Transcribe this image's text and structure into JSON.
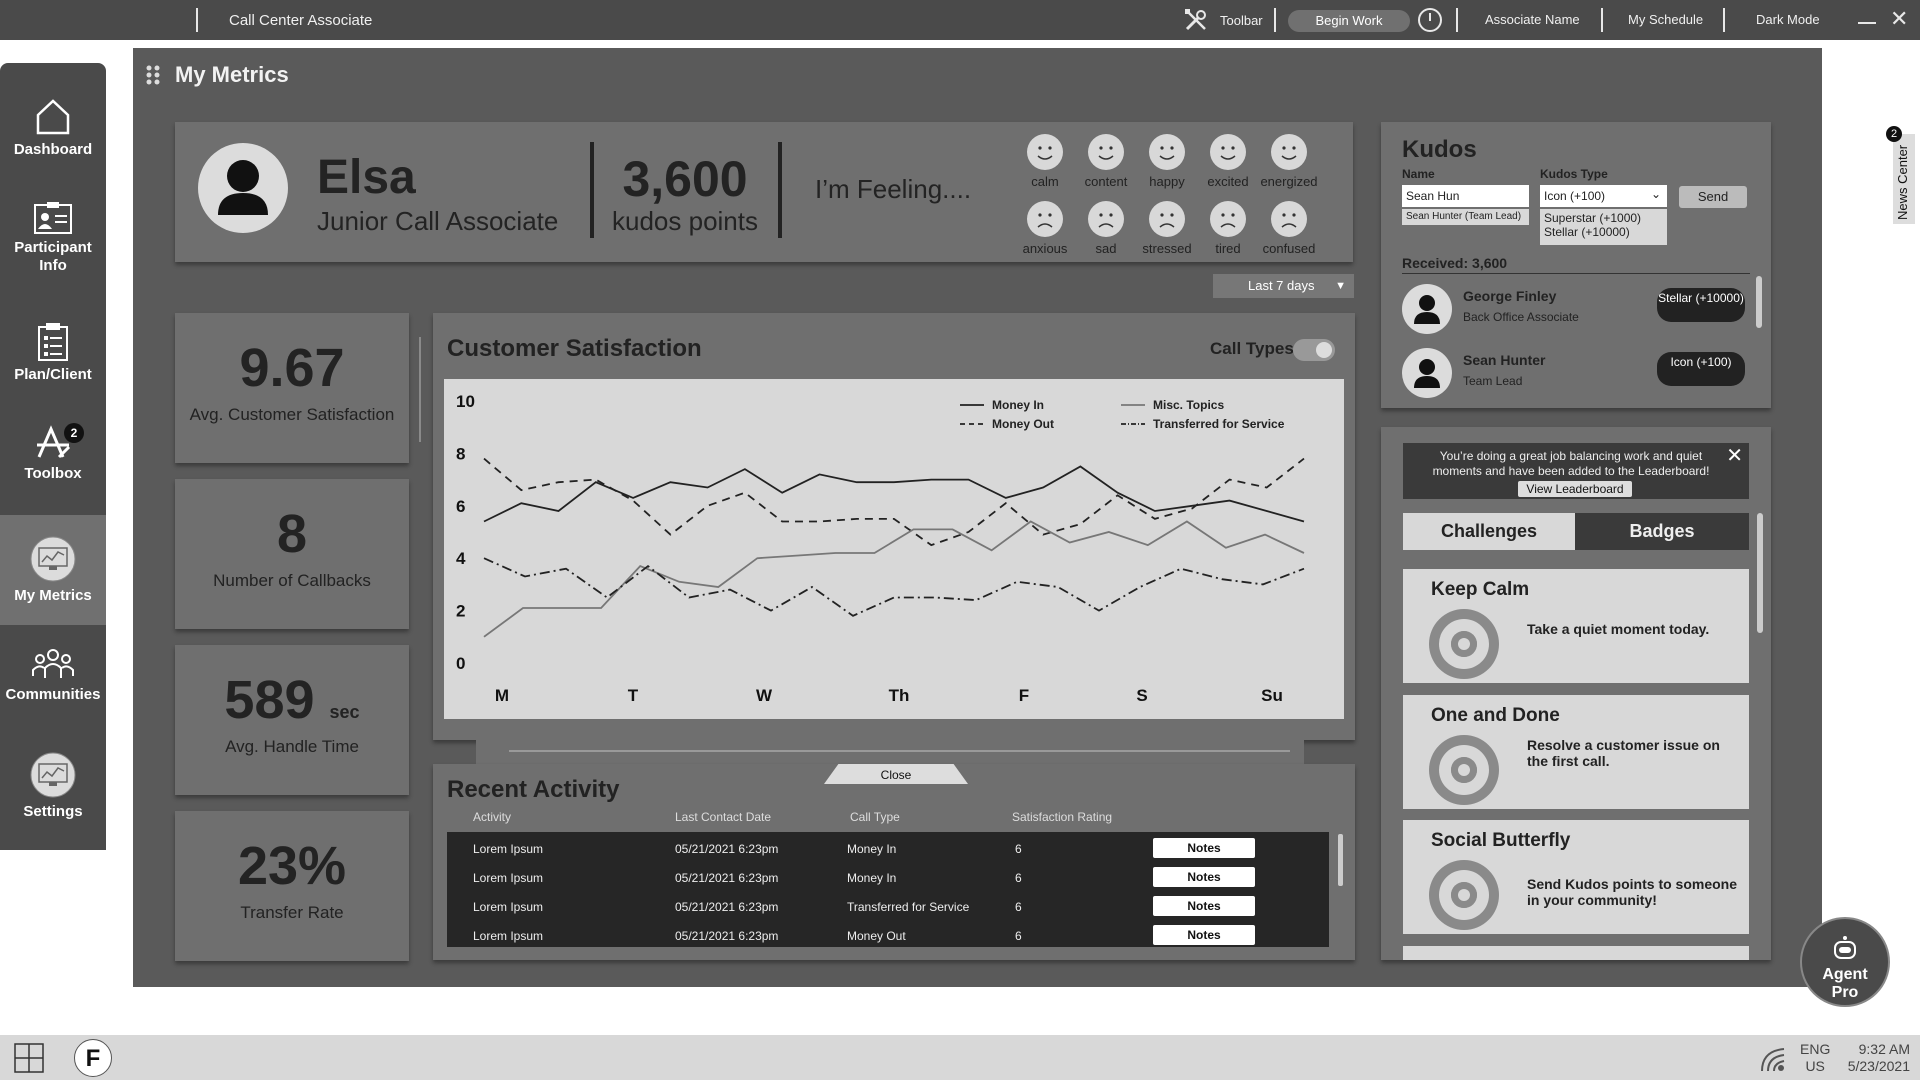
{
  "topbar": {
    "app_title": "Call Center Associate",
    "toolbar_label": "Toolbar",
    "begin_work": "Begin Work",
    "associate_name": "Associate Name",
    "my_schedule": "My Schedule",
    "dark_mode": "Dark Mode"
  },
  "sidebar": {
    "items": [
      {
        "label": "Dashboard",
        "icon": "home-icon"
      },
      {
        "label": "Participant Info",
        "icon": "id-card-icon"
      },
      {
        "label": "Plan/Client",
        "icon": "clipboard-icon"
      },
      {
        "label": "Toolbox",
        "icon": "toolbox-icon",
        "badge": "2"
      },
      {
        "label": "My Metrics",
        "icon": "metrics-icon",
        "active": true
      },
      {
        "label": "Communities",
        "icon": "communities-icon"
      },
      {
        "label": "Settings",
        "icon": "settings-icon"
      }
    ]
  },
  "page": {
    "title": "My Metrics"
  },
  "profile": {
    "name": "Elsa",
    "role": "Junior Call Associate",
    "kudos_value": "3,600",
    "kudos_label": "kudos points",
    "feeling_label": "I’m Feeling....",
    "moods": [
      "calm",
      "content",
      "happy",
      "excited",
      "energized",
      "anxious",
      "sad",
      "stressed",
      "tired",
      "confused"
    ]
  },
  "range_select": {
    "value": "Last 7 days"
  },
  "metrics": [
    {
      "value": "9.67",
      "unit": "",
      "label": "Avg. Customer Satisfaction"
    },
    {
      "value": "8",
      "unit": "",
      "label": "Number of Callbacks"
    },
    {
      "value": "589",
      "unit": "sec",
      "label": "Avg. Handle Time"
    },
    {
      "value": "23%",
      "unit": "",
      "label": "Transfer Rate"
    }
  ],
  "chart": {
    "title": "Customer Satisfaction",
    "toggle_label": "Call Types"
  },
  "chart_data": {
    "type": "line",
    "x": [
      "M",
      "T",
      "W",
      "Th",
      "F",
      "S",
      "Su"
    ],
    "ylim": [
      0,
      10
    ],
    "yticks": [
      0,
      2,
      4,
      6,
      8,
      10
    ],
    "legend_position": "top-right",
    "series": [
      {
        "name": "Money In",
        "style": "solid-dark",
        "values": [
          5.4,
          6.1,
          5.8,
          6.9,
          6.3,
          6.9,
          6.7,
          7.4,
          6.5,
          7.2,
          6.9,
          6.9,
          7.0,
          7.0,
          6.3,
          6.7,
          7.5,
          6.5,
          5.8,
          6.0,
          6.2,
          5.8,
          5.4
        ]
      },
      {
        "name": "Money Out",
        "style": "dashed",
        "values": [
          7.8,
          6.6,
          6.9,
          7.0,
          6.2,
          4.9,
          6.0,
          6.5,
          5.4,
          5.4,
          5.5,
          5.5,
          4.5,
          5.0,
          6.1,
          4.9,
          5.3,
          6.4,
          5.5,
          5.9,
          7.0,
          6.7,
          7.8
        ]
      },
      {
        "name": "Misc. Topics",
        "style": "solid-light",
        "values": [
          1.0,
          2.1,
          2.1,
          2.1,
          3.7,
          3.1,
          2.9,
          4.0,
          4.1,
          4.2,
          4.2,
          5.1,
          5.1,
          4.3,
          5.4,
          4.6,
          5.0,
          4.5,
          5.4,
          4.4,
          4.9,
          4.2
        ]
      },
      {
        "name": "Transferred for Service",
        "style": "dash-dot",
        "values": [
          4.0,
          3.3,
          3.6,
          2.5,
          3.7,
          2.5,
          2.8,
          2.0,
          2.9,
          1.8,
          2.5,
          2.5,
          2.4,
          3.1,
          2.9,
          2.0,
          2.9,
          3.6,
          3.2,
          3.0,
          3.6
        ]
      }
    ]
  },
  "activity": {
    "title": "Recent Activity",
    "close_label": "Close",
    "columns": [
      "Activity",
      "Last Contact Date",
      "Call Type",
      "Satisfaction Rating"
    ],
    "rows": [
      {
        "activity": "Lorem Ipsum",
        "date": "05/21/2021  6:23pm",
        "type": "Money In",
        "rating": "6",
        "notes": "Notes"
      },
      {
        "activity": "Lorem Ipsum",
        "date": "05/21/2021  6:23pm",
        "type": "Money In",
        "rating": "6",
        "notes": "Notes"
      },
      {
        "activity": "Lorem Ipsum",
        "date": "05/21/2021  6:23pm",
        "type": "Transferred for Service",
        "rating": "6",
        "notes": "Notes"
      },
      {
        "activity": "Lorem Ipsum",
        "date": "05/21/2021  6:23pm",
        "type": "Money Out",
        "rating": "6",
        "notes": "Notes"
      }
    ]
  },
  "kudos": {
    "title": "Kudos",
    "name_label": "Name",
    "type_label": "Kudos Type",
    "name_value": "Sean Hun",
    "name_suggestion": "Sean Hunter (Team Lead)",
    "type_value": "Icon (+100)",
    "type_options": [
      "Superstar (+1000)",
      "Stellar (+10000)"
    ],
    "send_label": "Send",
    "received_label": "Received: 3,600",
    "received": [
      {
        "name": "George Finley",
        "role": "Back Office Associate",
        "badge": "Stellar (+10000)"
      },
      {
        "name": "Sean Hunter",
        "role": "Team Lead",
        "badge": "Icon (+100)"
      }
    ]
  },
  "leaderboard": {
    "message": "You’re doing a great job balancing work and quiet moments and have been added to the Leaderboard!",
    "link": "View Leaderboard"
  },
  "tabs": {
    "challenges": "Challenges",
    "badges": "Badges"
  },
  "challenges": [
    {
      "title": "Keep Calm",
      "desc": "Take a quiet moment today."
    },
    {
      "title": "One and Done",
      "desc": "Resolve a customer issue on the first call."
    },
    {
      "title": "Social Butterfly",
      "desc": "Send Kudos points to someone in your community!"
    }
  ],
  "news_center": {
    "label": "News Center",
    "badge": "2"
  },
  "agent_pro": {
    "label": "Agent Pro"
  },
  "taskbar": {
    "app_letter": "F",
    "lang": "ENG",
    "region": "US",
    "time": "9:32 AM",
    "date": "5/23/2021"
  },
  "colors": {
    "topbar": "#4a4a4a",
    "main_bg": "#5a5a5a",
    "card": "#6f6f6f",
    "chart_bg": "#d8d8d8"
  }
}
